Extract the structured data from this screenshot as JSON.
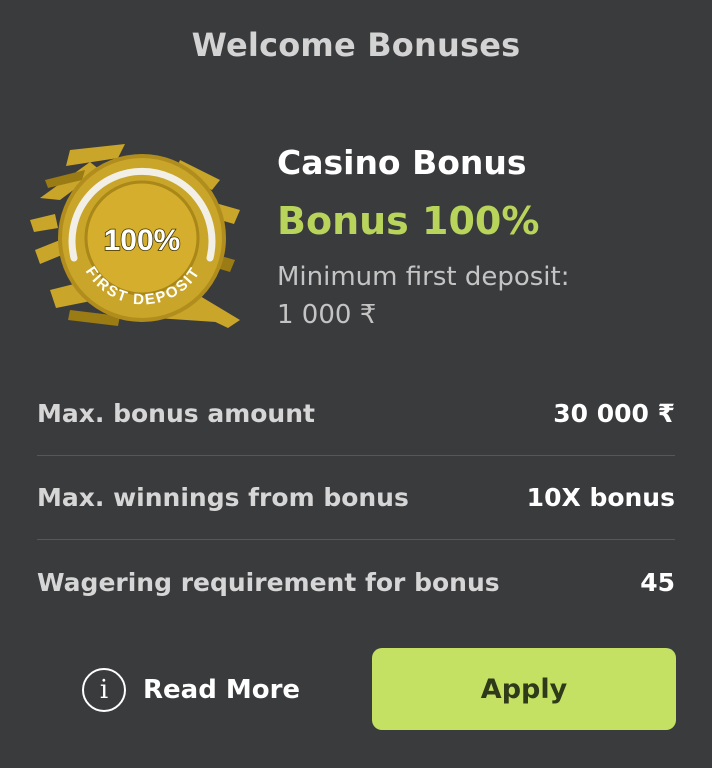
{
  "header": {
    "title": "Welcome Bonuses"
  },
  "badge": {
    "percent": "100%",
    "caption": "FIRST DEPOSIT",
    "colors": {
      "gold": "#c9a52a",
      "gold_dark": "#9a7b14",
      "gold_light": "#e2c24a"
    }
  },
  "bonus": {
    "name": "Casino Bonus",
    "percent_label": "Bonus 100%",
    "min_deposit_label": "Minimum first deposit:",
    "min_deposit_value": "1 000 ₹"
  },
  "details": [
    {
      "label": "Max. bonus amount",
      "value": "30 000 ₹"
    },
    {
      "label": "Max. winnings from bonus",
      "value": "10X bonus"
    },
    {
      "label": "Wagering requirement for bonus",
      "value": "45"
    }
  ],
  "actions": {
    "info_icon": "info-icon",
    "read_more_label": "Read More",
    "apply_label": "Apply"
  },
  "colors": {
    "background": "#3a3b3d",
    "accent": "#b9d45a",
    "button": "#c5e163"
  }
}
